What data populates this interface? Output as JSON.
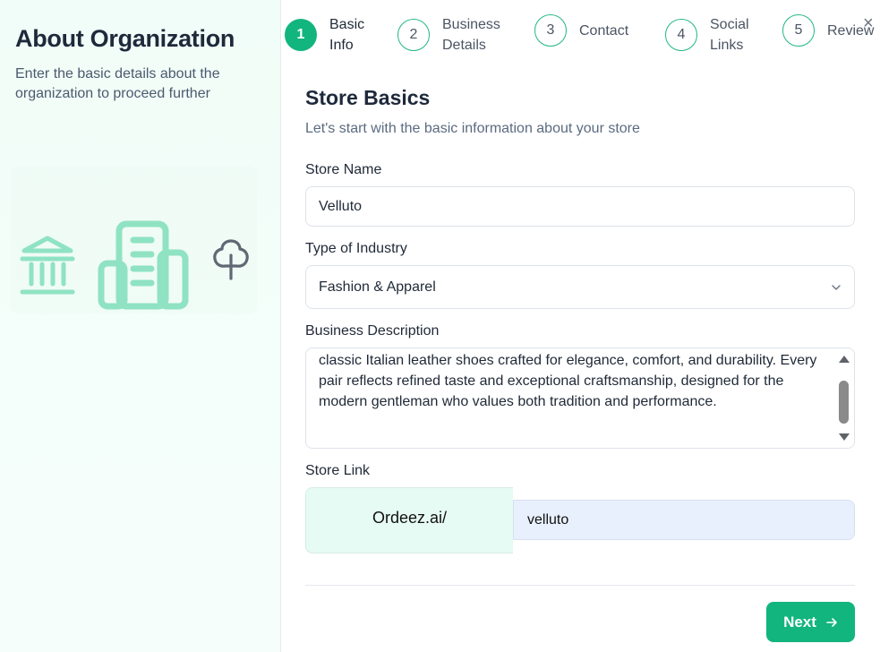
{
  "left": {
    "title": "About Organization",
    "subtitle": "Enter the basic details about the organization to proceed further",
    "icons": [
      "bank-icon",
      "building-icon",
      "tree-icon"
    ]
  },
  "stepper": {
    "steps": [
      {
        "number": "1",
        "label_line1": "Basic",
        "label_line2": "Info",
        "active": true
      },
      {
        "number": "2",
        "label_line1": "Business",
        "label_line2": "Details",
        "active": false
      },
      {
        "number": "3",
        "label_line1": "Contact",
        "label_line2": "",
        "active": false
      },
      {
        "number": "4",
        "label_line1": "Social",
        "label_line2": "Links",
        "active": false
      },
      {
        "number": "5",
        "label_line1": "Review",
        "label_line2": "",
        "active": false
      }
    ]
  },
  "close_label": "×",
  "form": {
    "title": "Store Basics",
    "subtitle": "Let's start with the basic information about your store",
    "store_name": {
      "label": "Store Name",
      "value": "Velluto"
    },
    "industry": {
      "label": "Type of Industry",
      "value": "Fashion & Apparel"
    },
    "description": {
      "label": "Business Description",
      "value": "classic Italian leather shoes crafted for elegance, comfort, and durability. Every pair reflects refined taste and exceptional craftsmanship, designed for the modern gentleman who values both tradition and performance."
    },
    "store_link": {
      "label": "Store Link",
      "prefix": "Ordeez.ai/",
      "value": "velluto"
    }
  },
  "footer": {
    "next_label": "Next"
  },
  "colors": {
    "accent": "#12b57e",
    "icon_green": "#8fe3c2",
    "tree_gray": "#5f6873"
  }
}
